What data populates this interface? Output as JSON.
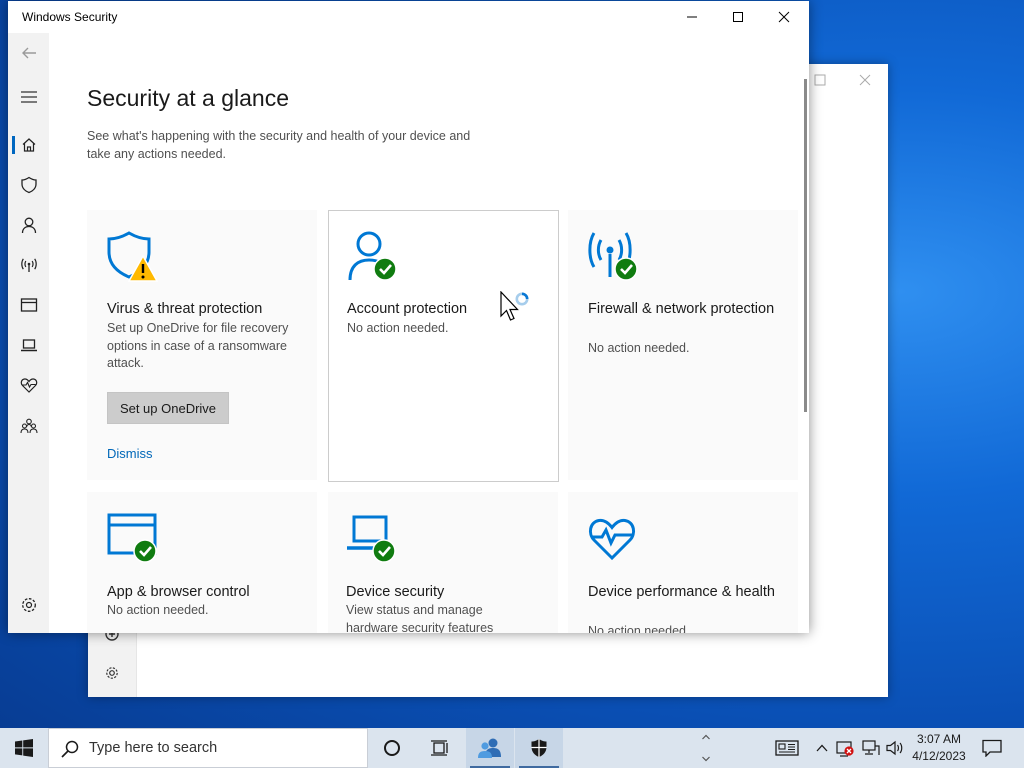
{
  "window": {
    "title": "Windows Security"
  },
  "sidebar": {
    "items": [
      {
        "icon": "back-arrow-icon",
        "label": "Back"
      },
      {
        "icon": "hamburger-menu-icon",
        "label": "Menu"
      },
      {
        "icon": "home-icon",
        "label": "Home",
        "active": true
      },
      {
        "icon": "shield-icon",
        "label": "Virus & threat protection"
      },
      {
        "icon": "person-icon",
        "label": "Account protection"
      },
      {
        "icon": "wireless-icon",
        "label": "Firewall & network protection"
      },
      {
        "icon": "browser-window-icon",
        "label": "App & browser control"
      },
      {
        "icon": "laptop-icon",
        "label": "Device security"
      },
      {
        "icon": "heart-pulse-icon",
        "label": "Device performance & health"
      },
      {
        "icon": "family-icon",
        "label": "Family options"
      },
      {
        "icon": "settings-gear-icon",
        "label": "Settings"
      }
    ]
  },
  "main": {
    "title": "Security at a glance",
    "subtitle": "See what's happening with the security and health of your device and take any actions needed.",
    "tiles": [
      {
        "title": "Virus & threat protection",
        "description": "Set up OneDrive for file recovery options in case of a ransomware attack.",
        "button_label": "Set up OneDrive",
        "link_label": "Dismiss",
        "status": "warning"
      },
      {
        "title": "Account protection",
        "description": "No action needed.",
        "status": "ok"
      },
      {
        "title": "Firewall & network protection",
        "description": "No action needed.",
        "status": "ok"
      },
      {
        "title": "App & browser control",
        "description": "No action needed.",
        "status": "ok"
      },
      {
        "title": "Device security",
        "description": "View status and manage hardware security features",
        "status": "ok"
      },
      {
        "title": "Device performance & health",
        "description": "No action needed.",
        "status": "ok"
      }
    ]
  },
  "taskbar": {
    "search_placeholder": "Type here to search",
    "clock_time": "3:07 AM",
    "clock_date": "4/12/2023"
  },
  "colors": {
    "accent": "#0067c0",
    "ok_green": "#107c10",
    "warning_yellow": "#ffb900",
    "icon_blue": "#0078d4"
  }
}
